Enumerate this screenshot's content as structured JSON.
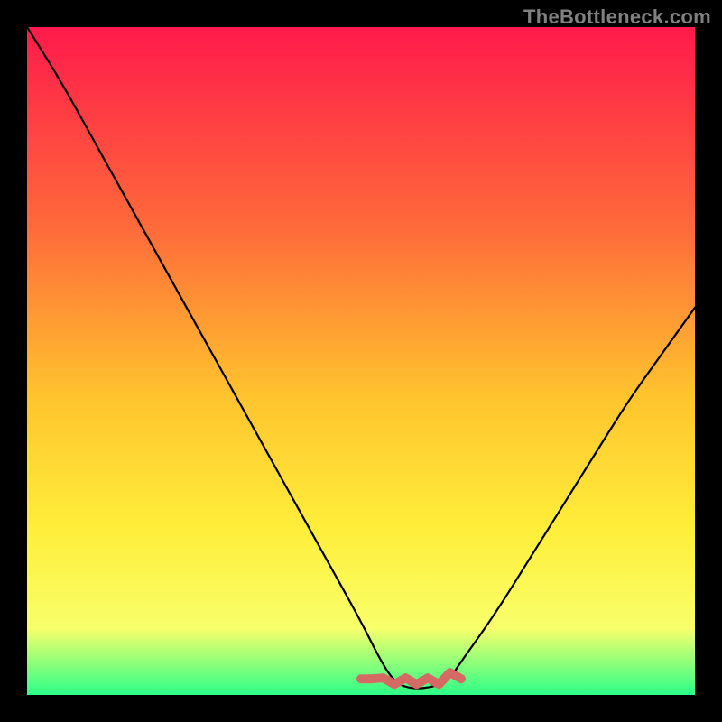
{
  "watermark": "TheBottleneck.com",
  "colors": {
    "background": "#000000",
    "gradient_top": "#ff1a4b",
    "gradient_mid1": "#ff6a3a",
    "gradient_mid2": "#ffc32e",
    "gradient_mid3": "#ffee3a",
    "gradient_mid4": "#f8ff6a",
    "gradient_bottom": "#2cff88",
    "curve": "#000000",
    "highlight": "#d46a63"
  },
  "chart_data": {
    "type": "line",
    "title": "",
    "xlabel": "",
    "ylabel": "",
    "xlim": [
      0,
      100
    ],
    "ylim": [
      0,
      100
    ],
    "grid": false,
    "legend": false,
    "series": [
      {
        "name": "bottleneck-curve",
        "x": [
          0,
          5,
          10,
          15,
          20,
          25,
          30,
          35,
          40,
          45,
          50,
          53,
          55,
          57,
          60,
          63,
          65,
          70,
          75,
          80,
          85,
          90,
          95,
          100
        ],
        "y": [
          100,
          92,
          83,
          74,
          65,
          56,
          47,
          38,
          29,
          20,
          11,
          5,
          2,
          1,
          1,
          2,
          5,
          12,
          20,
          28,
          36,
          44,
          51,
          58
        ]
      }
    ],
    "highlight_region": {
      "x_start": 50,
      "x_end": 65,
      "y_level": 2
    }
  }
}
